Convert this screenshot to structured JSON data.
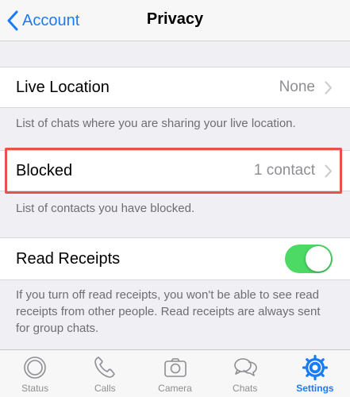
{
  "navbar": {
    "back_label": "Account",
    "title": "Privacy"
  },
  "rows": {
    "live_location": {
      "title": "Live Location",
      "value": "None",
      "footer": "List of chats where you are sharing your live location."
    },
    "blocked": {
      "title": "Blocked",
      "value": "1 contact",
      "footer": "List of contacts you have blocked."
    },
    "read_receipts": {
      "title": "Read Receipts",
      "enabled": true,
      "footer": "If you turn off read receipts, you won't be able to see read receipts from other people. Read receipts are always sent for group chats."
    }
  },
  "tabbar": {
    "items": [
      {
        "label": "Status",
        "icon": "status-icon",
        "active": false
      },
      {
        "label": "Calls",
        "icon": "phone-icon",
        "active": false
      },
      {
        "label": "Camera",
        "icon": "camera-icon",
        "active": false
      },
      {
        "label": "Chats",
        "icon": "chat-bubbles-icon",
        "active": false
      },
      {
        "label": "Settings",
        "icon": "gear-icon",
        "active": true
      }
    ]
  },
  "colors": {
    "accent": "#1a7cf5",
    "toggle_on": "#4cd964",
    "highlight": "#e8524a",
    "background": "#efeff4"
  }
}
